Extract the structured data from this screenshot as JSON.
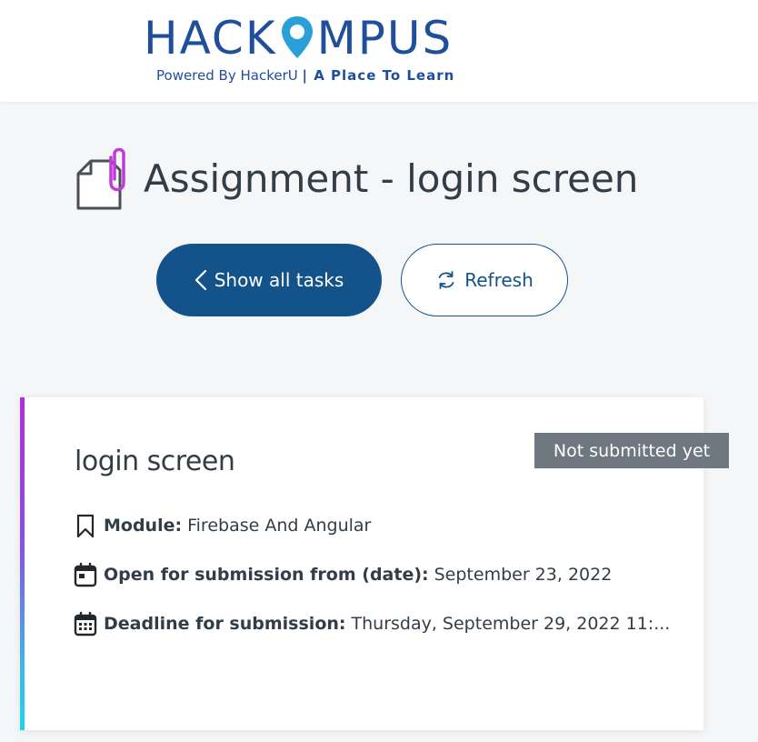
{
  "header": {
    "logo_text": "HACKOMPUS",
    "logo_left": "HACK",
    "logo_right": "MPUS",
    "tagline_prefix": "Powered By HackerU",
    "tagline_suffix": "| A Place To Learn",
    "brand_color": "#1f4e9c"
  },
  "page": {
    "title": "Assignment - login screen",
    "title_icon": "file-attachment-icon"
  },
  "actions": {
    "show_all_label": "Show all tasks",
    "refresh_label": "Refresh",
    "primary_color": "#14528a"
  },
  "card": {
    "status": "Not submitted yet",
    "title": "login screen",
    "rows": [
      {
        "icon": "bookmark-icon",
        "label": "Module:",
        "value": "Firebase And Angular"
      },
      {
        "icon": "calendar-icon",
        "label": "Open for submission from (date):",
        "value": "September 23, 2022"
      },
      {
        "icon": "calendar-grid-icon",
        "label": "Deadline for submission:",
        "value": "Thursday, September 29, 2022 11:..."
      }
    ]
  }
}
